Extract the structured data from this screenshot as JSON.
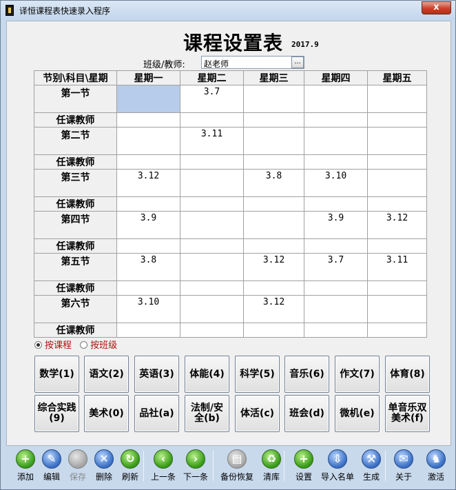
{
  "window": {
    "title": "译恒课程表快速录入程序",
    "close_label": "x"
  },
  "header": {
    "title": "课程设置表",
    "subtitle": "2017.9",
    "class_label": "班级/教师:",
    "class_value": "赵老师",
    "browse_label": "..."
  },
  "grid": {
    "corner": "节别\\科目\\星期",
    "days": [
      "星期一",
      "星期二",
      "星期三",
      "星期四",
      "星期五"
    ],
    "teacher_label": "任课教师",
    "periods": [
      {
        "name": "第一节",
        "cells": [
          "",
          "3.7",
          "",
          "",
          ""
        ]
      },
      {
        "name": "第二节",
        "cells": [
          "",
          "3.11",
          "",
          "",
          ""
        ]
      },
      {
        "name": "第三节",
        "cells": [
          "3.12",
          "",
          "3.8",
          "3.10",
          ""
        ]
      },
      {
        "name": "第四节",
        "cells": [
          "3.9",
          "",
          "",
          "3.9",
          "3.12"
        ]
      },
      {
        "name": "第五节",
        "cells": [
          "3.8",
          "",
          "3.12",
          "3.7",
          "3.11"
        ]
      },
      {
        "name": "第六节",
        "cells": [
          "3.10",
          "",
          "3.12",
          "",
          ""
        ]
      }
    ]
  },
  "mode": {
    "by_course": "按课程",
    "by_class": "按班级",
    "selected": "by_course"
  },
  "subjects": {
    "row1": [
      "数学(1)",
      "语文(2)",
      "英语(3)",
      "体能(4)",
      "科学(5)",
      "音乐(6)",
      "作文(7)",
      "体育(8)"
    ],
    "row2": [
      "综合实践(9)",
      "美术(0)",
      "品社(a)",
      "法制/安全(b)",
      "体活(c)",
      "班会(d)",
      "微机(e)",
      "单音乐双美术(f)"
    ]
  },
  "toolbar": {
    "add": "添加",
    "edit": "编辑",
    "save": "保存",
    "delete": "删除",
    "refresh": "刷新",
    "prev": "上一条",
    "next": "下一条",
    "backup": "备份恢复",
    "clear": "清库",
    "settings": "设置",
    "import": "导入名单",
    "generate": "生成",
    "about": "关于",
    "activate": "激活"
  },
  "colors": {
    "selected_cell": "#b7cceb",
    "mode_label": "#b01010",
    "toolbar_green": "#3c9e1c",
    "toolbar_blue": "#3d73c8"
  }
}
